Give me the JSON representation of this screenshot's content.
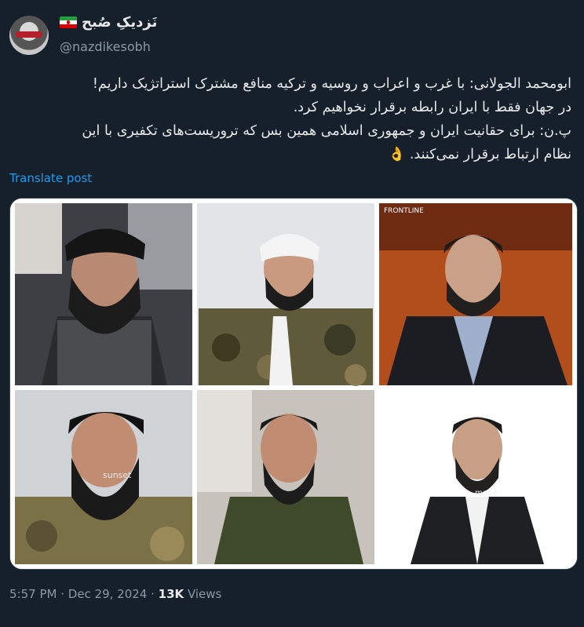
{
  "author": {
    "display_name": "نَزدیکِ صُبح",
    "handle": "@nazdikesobh"
  },
  "post": {
    "lines": [
      "ابومحمد الجولانی: با غرب و اعراب و روسیه و ترکیه منافع مشترک استراتژیک داریم!",
      "در جهان فقط با ایران رابطه برقرار نخواهیم کرد.",
      "پ.ن: برای حقانیت ایران و جمهوری اسلامی همین بس که تروریست‌های تکفیری با این",
      "نظام ارتباط برقرار نمی‌کنند. 👌"
    ],
    "translate_label": "Translate post"
  },
  "media": {
    "watermarks": {
      "frontline": "FRONTLINE",
      "sunset": "sunset",
      "mood": "mood"
    }
  },
  "meta": {
    "time": "5:57 PM",
    "separator": " · ",
    "date": "Dec 29, 2024",
    "views_count": "13K",
    "views_label": " Views"
  },
  "colors": {
    "background": "#15202b",
    "text": "#e7e9ea",
    "muted": "#8b98a5",
    "link": "#1d9bf0"
  },
  "icons": [
    "avatar-image",
    "iran-flag-icon"
  ]
}
